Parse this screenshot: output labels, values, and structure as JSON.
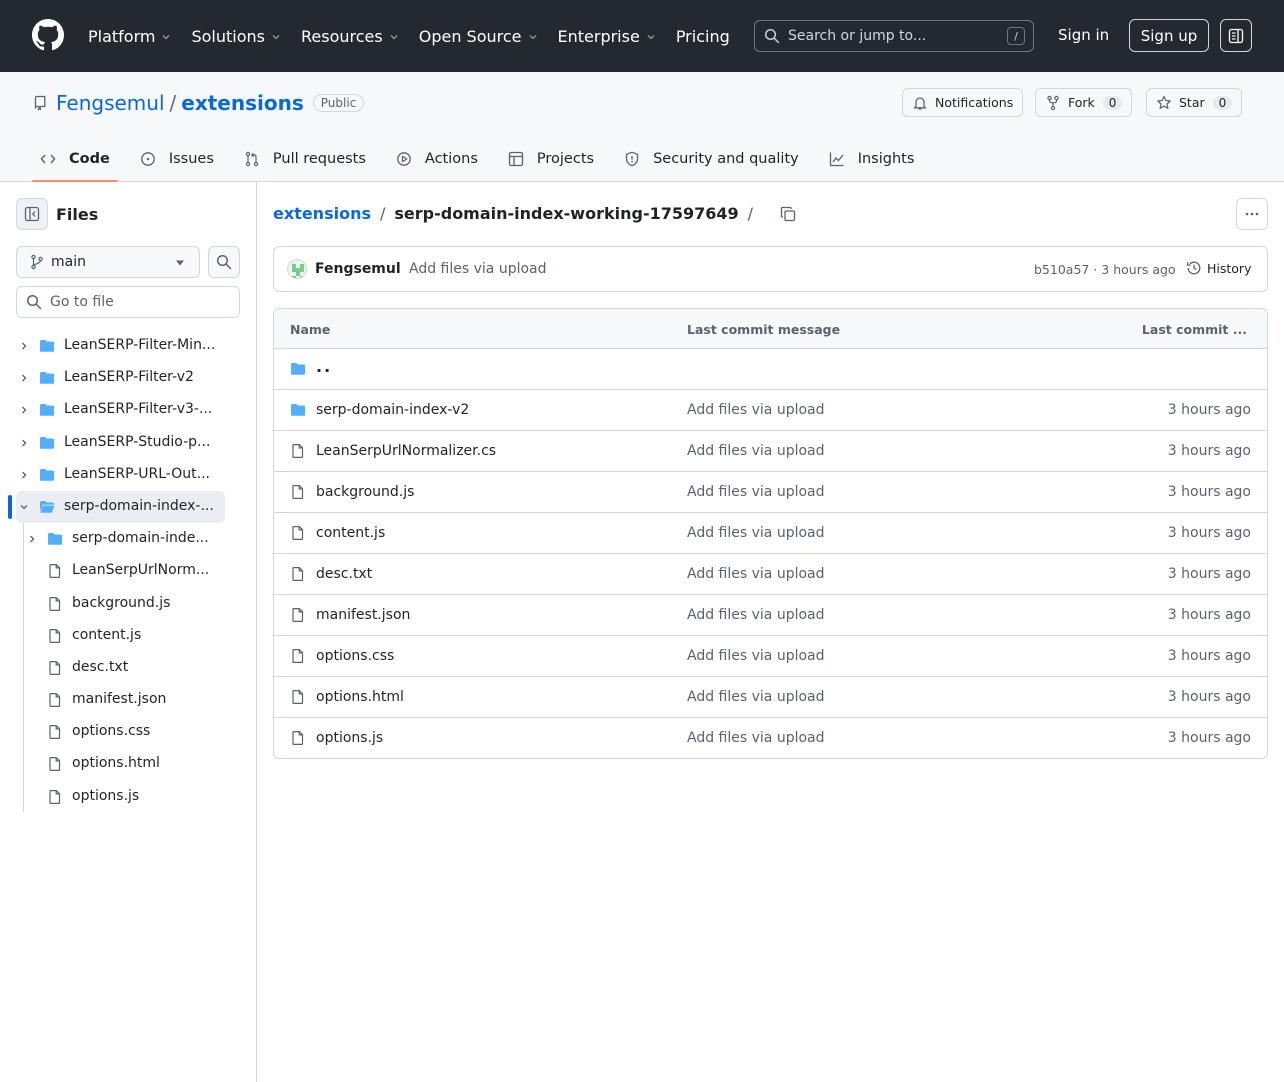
{
  "header": {
    "nav": [
      {
        "label": "Platform",
        "dropdown": true
      },
      {
        "label": "Solutions",
        "dropdown": true
      },
      {
        "label": "Resources",
        "dropdown": true
      },
      {
        "label": "Open Source",
        "dropdown": true
      },
      {
        "label": "Enterprise",
        "dropdown": true
      },
      {
        "label": "Pricing",
        "dropdown": false
      }
    ],
    "search_placeholder": "Search or jump to...",
    "search_shortcut": "/",
    "sign_in": "Sign in",
    "sign_up": "Sign up"
  },
  "repo": {
    "owner": "Fengsemul",
    "separator": "/",
    "name": "extensions",
    "visibility": "Public",
    "notifications_label": "Notifications",
    "fork_label": "Fork",
    "fork_count": "0",
    "star_label": "Star",
    "star_count": "0",
    "tabs": [
      {
        "label": "Code",
        "icon": "code-icon",
        "active": true
      },
      {
        "label": "Issues",
        "icon": "issue-icon",
        "active": false
      },
      {
        "label": "Pull requests",
        "icon": "pull-request-icon",
        "active": false
      },
      {
        "label": "Actions",
        "icon": "play-icon",
        "active": false
      },
      {
        "label": "Projects",
        "icon": "table-icon",
        "active": false
      },
      {
        "label": "Security and quality",
        "icon": "shield-icon",
        "active": false
      },
      {
        "label": "Insights",
        "icon": "graph-icon",
        "active": false
      }
    ]
  },
  "sidebar": {
    "title": "Files",
    "branch": "main",
    "goto_placeholder": "Go to file",
    "tree": [
      {
        "label": "LeanSERP-Filter-Min...",
        "type": "dir",
        "depth": 0,
        "expanded": false,
        "selected": false
      },
      {
        "label": "LeanSERP-Filter-v2",
        "type": "dir",
        "depth": 0,
        "expanded": false,
        "selected": false
      },
      {
        "label": "LeanSERP-Filter-v3-...",
        "type": "dir",
        "depth": 0,
        "expanded": false,
        "selected": false
      },
      {
        "label": "LeanSERP-Studio-p...",
        "type": "dir",
        "depth": 0,
        "expanded": false,
        "selected": false
      },
      {
        "label": "LeanSERP-URL-Out...",
        "type": "dir",
        "depth": 0,
        "expanded": false,
        "selected": false
      },
      {
        "label": "serp-domain-index-...",
        "type": "dir",
        "depth": 0,
        "expanded": true,
        "selected": true
      },
      {
        "label": "serp-domain-inde...",
        "type": "dir",
        "depth": 1,
        "expanded": false,
        "selected": false
      },
      {
        "label": "LeanSerpUrlNorm...",
        "type": "file",
        "depth": 1,
        "selected": false
      },
      {
        "label": "background.js",
        "type": "file",
        "depth": 1,
        "selected": false
      },
      {
        "label": "content.js",
        "type": "file",
        "depth": 1,
        "selected": false
      },
      {
        "label": "desc.txt",
        "type": "file",
        "depth": 1,
        "selected": false
      },
      {
        "label": "manifest.json",
        "type": "file",
        "depth": 1,
        "selected": false
      },
      {
        "label": "options.css",
        "type": "file",
        "depth": 1,
        "selected": false
      },
      {
        "label": "options.html",
        "type": "file",
        "depth": 1,
        "selected": false
      },
      {
        "label": "options.js",
        "type": "file",
        "depth": 1,
        "selected": false
      }
    ]
  },
  "main": {
    "breadcrumb_root": "extensions",
    "breadcrumb_sep": "/",
    "breadcrumb_current": "serp-domain-index-working-17597649",
    "breadcrumb_trailing": "/",
    "commit": {
      "author": "Fengsemul",
      "message": "Add files via upload",
      "sha_time": "b510a57 · 3 hours ago",
      "history_label": "History"
    },
    "table_headers": {
      "name": "Name",
      "message": "Last commit message",
      "date": "Last commit ..."
    },
    "parent_dir": "..",
    "files": [
      {
        "name": "serp-domain-index-v2",
        "type": "dir",
        "message": "Add files via upload",
        "date": "3 hours ago"
      },
      {
        "name": "LeanSerpUrlNormalizer.cs",
        "type": "file",
        "message": "Add files via upload",
        "date": "3 hours ago"
      },
      {
        "name": "background.js",
        "type": "file",
        "message": "Add files via upload",
        "date": "3 hours ago"
      },
      {
        "name": "content.js",
        "type": "file",
        "message": "Add files via upload",
        "date": "3 hours ago"
      },
      {
        "name": "desc.txt",
        "type": "file",
        "message": "Add files via upload",
        "date": "3 hours ago"
      },
      {
        "name": "manifest.json",
        "type": "file",
        "message": "Add files via upload",
        "date": "3 hours ago"
      },
      {
        "name": "options.css",
        "type": "file",
        "message": "Add files via upload",
        "date": "3 hours ago"
      },
      {
        "name": "options.html",
        "type": "file",
        "message": "Add files via upload",
        "date": "3 hours ago"
      },
      {
        "name": "options.js",
        "type": "file",
        "message": "Add files via upload",
        "date": "3 hours ago"
      }
    ]
  },
  "colors": {
    "header_bg": "#24292f",
    "link": "#0969da",
    "folder": "#54aeff",
    "tab_underline": "#fd8c73",
    "selection_bar": "#0969da"
  }
}
